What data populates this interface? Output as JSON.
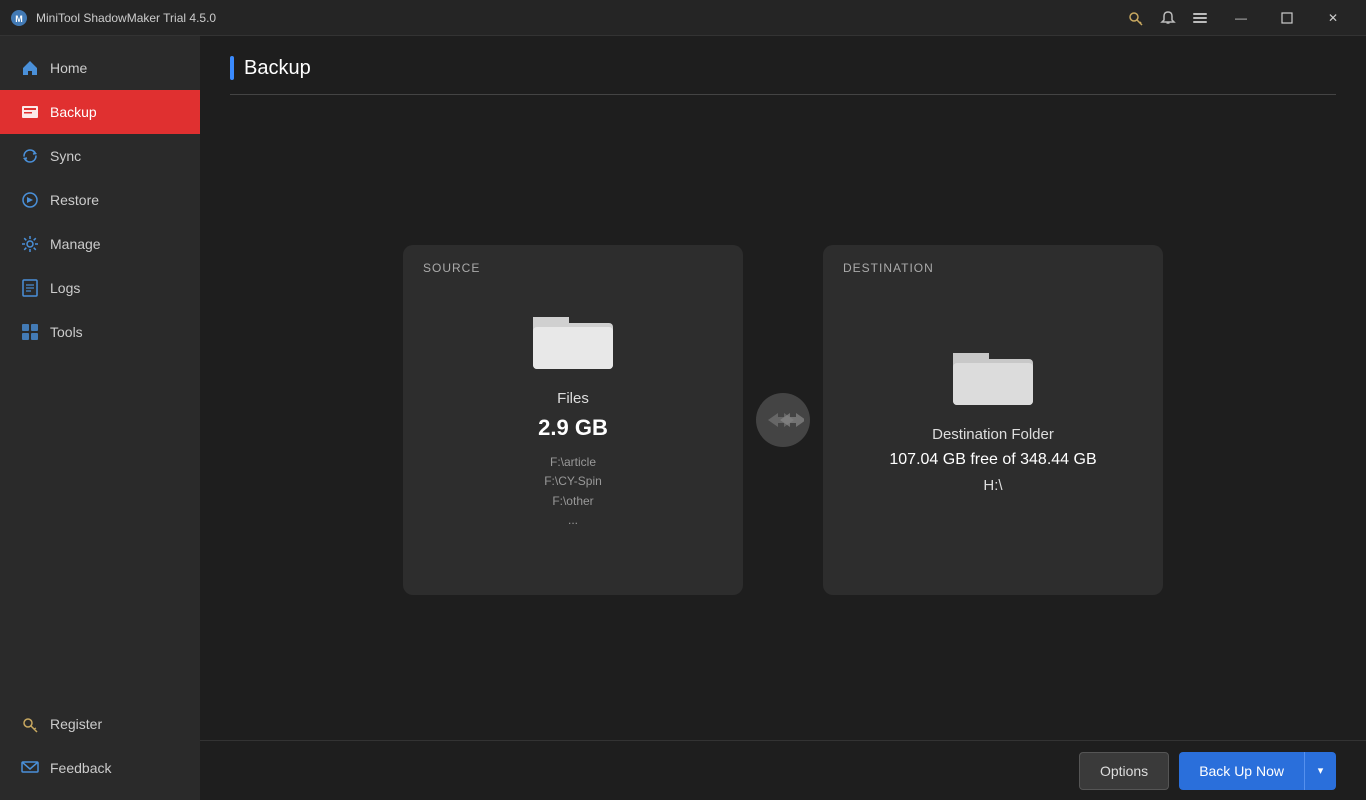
{
  "app": {
    "title": "MiniTool ShadowMaker Trial 4.5.0"
  },
  "titlebar": {
    "icons": {
      "key": "🔑",
      "lock": "🔒",
      "menu": "☰"
    },
    "controls": {
      "minimize": "—",
      "restore": "❐",
      "close": "✕"
    }
  },
  "sidebar": {
    "items": [
      {
        "id": "home",
        "label": "Home",
        "active": false
      },
      {
        "id": "backup",
        "label": "Backup",
        "active": true
      },
      {
        "id": "sync",
        "label": "Sync",
        "active": false
      },
      {
        "id": "restore",
        "label": "Restore",
        "active": false
      },
      {
        "id": "manage",
        "label": "Manage",
        "active": false
      },
      {
        "id": "logs",
        "label": "Logs",
        "active": false
      },
      {
        "id": "tools",
        "label": "Tools",
        "active": false
      }
    ],
    "bottom": [
      {
        "id": "register",
        "label": "Register"
      },
      {
        "id": "feedback",
        "label": "Feedback"
      }
    ]
  },
  "page": {
    "title": "Backup"
  },
  "source": {
    "label": "SOURCE",
    "name": "Files",
    "size": "2.9 GB",
    "paths": [
      "F:\\article",
      "F:\\CY-Spin",
      "F:\\other",
      "..."
    ]
  },
  "destination": {
    "label": "DESTINATION",
    "name": "Destination Folder",
    "free": "107.04 GB free of 348.44 GB",
    "drive": "H:\\"
  },
  "buttons": {
    "options": "Options",
    "backup_now": "Back Up Now",
    "dropdown_arrow": "▾"
  }
}
